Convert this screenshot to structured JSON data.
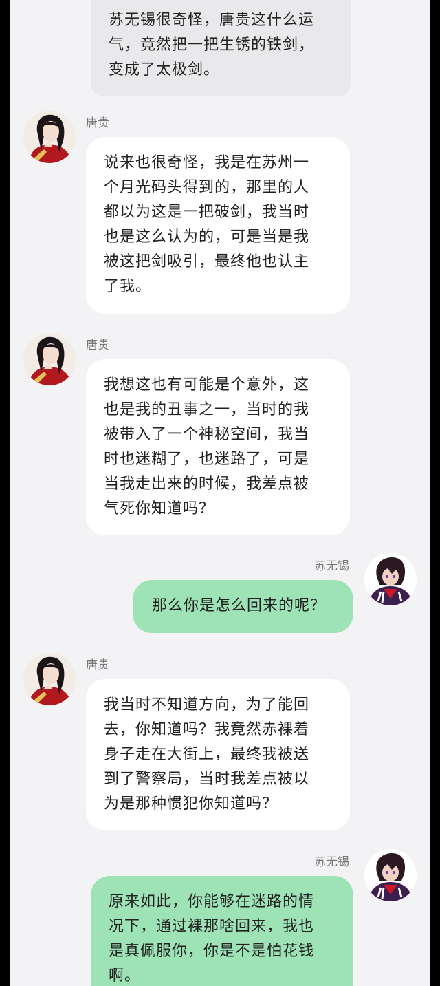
{
  "chat": {
    "messages": [
      {
        "sender": "",
        "side": "out-top",
        "text": "苏无锡很奇怪，唐贵这什么运\n气，竟然把一把生锈的铁剑，\n变成了太极剑。"
      },
      {
        "sender": "唐贵",
        "side": "in",
        "text": "说来也很奇怪，我是在苏州一\n个月光码头得到的，那里的人\n都以为这是一把破剑，我当时\n也是这么认为的，可是当是我\n被这把剑吸引，最终他也认主\n了我。"
      },
      {
        "sender": "唐贵",
        "side": "in",
        "text": "我想这也有可能是个意外，这\n也是我的丑事之一，当时的我\n被带入了一个神秘空间，我当\n时也迷糊了，也迷路了，可是\n当我走出来的时候，我差点被\n气死你知道吗？"
      },
      {
        "sender": "苏无锡",
        "side": "out",
        "text": "那么你是怎么回来的呢？"
      },
      {
        "sender": "唐贵",
        "side": "in",
        "text": "我当时不知道方向，为了能回\n去，你知道吗？我竟然赤裸着\n身子走在大街上，最终我被送\n到了警察局，当时我差点被以\n为是那种惯犯你知道吗？"
      },
      {
        "sender": "苏无锡",
        "side": "out",
        "text": "原来如此，你能够在迷路的情\n况下，通过裸那啥回来，我也\n是真佩服你，你是不是怕花钱\n啊。"
      }
    ]
  },
  "colors": {
    "page_bg": "#f3f3f5",
    "incoming_bubble": "#ffffff",
    "outgoing_bubble": "#9de3b6",
    "top_bubble": "#e9e9eb",
    "side_bars": "#000000"
  },
  "icons": {
    "tanggui_avatar": "avatar-tanggui-icon",
    "suwuxi_avatar": "avatar-suwuxi-icon"
  }
}
